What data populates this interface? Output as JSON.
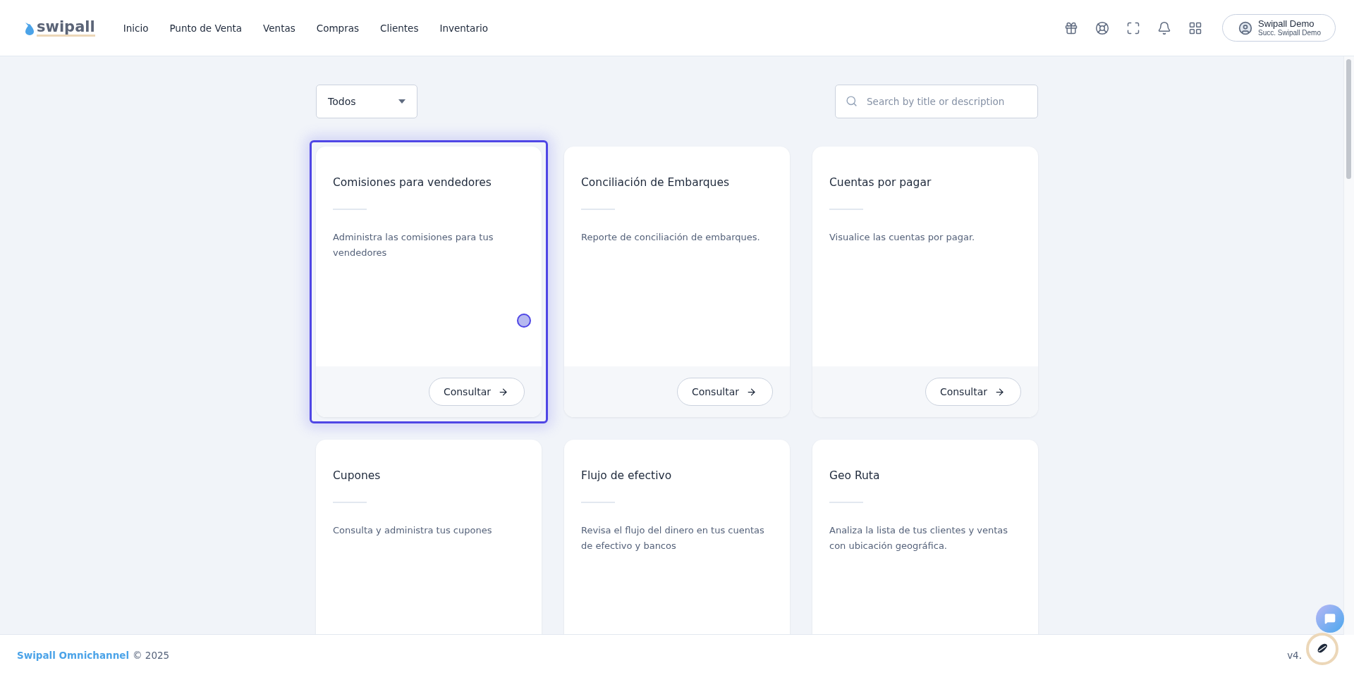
{
  "header": {
    "logo": "swipall",
    "nav": [
      {
        "label": "Inicio"
      },
      {
        "label": "Punto de Venta"
      },
      {
        "label": "Ventas"
      },
      {
        "label": "Compras"
      },
      {
        "label": "Clientes"
      },
      {
        "label": "Inventario"
      }
    ],
    "user": {
      "name": "Swipall Demo",
      "branch": "Succ. Swipall Demo"
    }
  },
  "filter": {
    "value": "Todos"
  },
  "search": {
    "placeholder": "Search by title or description"
  },
  "cards": [
    {
      "title": "Comisiones para vendedores",
      "description": "Administra las comisiones para tus vendedores",
      "button": "Consultar",
      "selected": true
    },
    {
      "title": "Conciliación de Embarques",
      "description": "Reporte de conciliación de embarques.",
      "button": "Consultar",
      "selected": false
    },
    {
      "title": "Cuentas por pagar",
      "description": "Visualice las cuentas por pagar.",
      "button": "Consultar",
      "selected": false
    },
    {
      "title": "Cupones",
      "description": "Consulta y administra tus cupones",
      "selected": false
    },
    {
      "title": "Flujo de efectivo",
      "description": "Revisa el flujo del dinero en tus cuentas de efectivo y bancos",
      "selected": false
    },
    {
      "title": "Geo Ruta",
      "description": "Analiza la lista de tus clientes y ventas con ubicación geográfica.",
      "selected": false
    }
  ],
  "footer": {
    "brand": "Swipall Omnichannel",
    "copyright": "© 2025",
    "version": "v4."
  }
}
